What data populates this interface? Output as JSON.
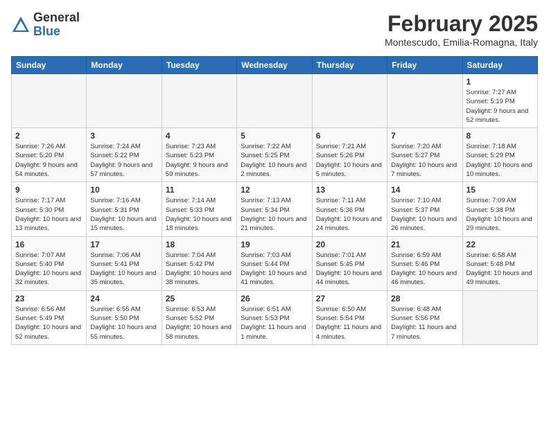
{
  "header": {
    "logo": {
      "general": "General",
      "blue": "Blue"
    },
    "title": "February 2025",
    "subtitle": "Montescudo, Emilia-Romagna, Italy"
  },
  "calendar": {
    "weekdays": [
      "Sunday",
      "Monday",
      "Tuesday",
      "Wednesday",
      "Thursday",
      "Friday",
      "Saturday"
    ],
    "weeks": [
      [
        {
          "day": "",
          "info": ""
        },
        {
          "day": "",
          "info": ""
        },
        {
          "day": "",
          "info": ""
        },
        {
          "day": "",
          "info": ""
        },
        {
          "day": "",
          "info": ""
        },
        {
          "day": "",
          "info": ""
        },
        {
          "day": "1",
          "info": "Sunrise: 7:27 AM\nSunset: 5:19 PM\nDaylight: 9 hours and 52 minutes."
        }
      ],
      [
        {
          "day": "2",
          "info": "Sunrise: 7:26 AM\nSunset: 5:20 PM\nDaylight: 9 hours and 54 minutes."
        },
        {
          "day": "3",
          "info": "Sunrise: 7:24 AM\nSunset: 5:22 PM\nDaylight: 9 hours and 57 minutes."
        },
        {
          "day": "4",
          "info": "Sunrise: 7:23 AM\nSunset: 5:23 PM\nDaylight: 9 hours and 59 minutes."
        },
        {
          "day": "5",
          "info": "Sunrise: 7:22 AM\nSunset: 5:25 PM\nDaylight: 10 hours and 2 minutes."
        },
        {
          "day": "6",
          "info": "Sunrise: 7:21 AM\nSunset: 5:26 PM\nDaylight: 10 hours and 5 minutes."
        },
        {
          "day": "7",
          "info": "Sunrise: 7:20 AM\nSunset: 5:27 PM\nDaylight: 10 hours and 7 minutes."
        },
        {
          "day": "8",
          "info": "Sunrise: 7:18 AM\nSunset: 5:29 PM\nDaylight: 10 hours and 10 minutes."
        }
      ],
      [
        {
          "day": "9",
          "info": "Sunrise: 7:17 AM\nSunset: 5:30 PM\nDaylight: 10 hours and 13 minutes."
        },
        {
          "day": "10",
          "info": "Sunrise: 7:16 AM\nSunset: 5:31 PM\nDaylight: 10 hours and 15 minutes."
        },
        {
          "day": "11",
          "info": "Sunrise: 7:14 AM\nSunset: 5:33 PM\nDaylight: 10 hours and 18 minutes."
        },
        {
          "day": "12",
          "info": "Sunrise: 7:13 AM\nSunset: 5:34 PM\nDaylight: 10 hours and 21 minutes."
        },
        {
          "day": "13",
          "info": "Sunrise: 7:11 AM\nSunset: 5:36 PM\nDaylight: 10 hours and 24 minutes."
        },
        {
          "day": "14",
          "info": "Sunrise: 7:10 AM\nSunset: 5:37 PM\nDaylight: 10 hours and 26 minutes."
        },
        {
          "day": "15",
          "info": "Sunrise: 7:09 AM\nSunset: 5:38 PM\nDaylight: 10 hours and 29 minutes."
        }
      ],
      [
        {
          "day": "16",
          "info": "Sunrise: 7:07 AM\nSunset: 5:40 PM\nDaylight: 10 hours and 32 minutes."
        },
        {
          "day": "17",
          "info": "Sunrise: 7:06 AM\nSunset: 5:41 PM\nDaylight: 10 hours and 35 minutes."
        },
        {
          "day": "18",
          "info": "Sunrise: 7:04 AM\nSunset: 5:42 PM\nDaylight: 10 hours and 38 minutes."
        },
        {
          "day": "19",
          "info": "Sunrise: 7:03 AM\nSunset: 5:44 PM\nDaylight: 10 hours and 41 minutes."
        },
        {
          "day": "20",
          "info": "Sunrise: 7:01 AM\nSunset: 5:45 PM\nDaylight: 10 hours and 44 minutes."
        },
        {
          "day": "21",
          "info": "Sunrise: 6:59 AM\nSunset: 5:46 PM\nDaylight: 10 hours and 46 minutes."
        },
        {
          "day": "22",
          "info": "Sunrise: 6:58 AM\nSunset: 5:48 PM\nDaylight: 10 hours and 49 minutes."
        }
      ],
      [
        {
          "day": "23",
          "info": "Sunrise: 6:56 AM\nSunset: 5:49 PM\nDaylight: 10 hours and 52 minutes."
        },
        {
          "day": "24",
          "info": "Sunrise: 6:55 AM\nSunset: 5:50 PM\nDaylight: 10 hours and 55 minutes."
        },
        {
          "day": "25",
          "info": "Sunrise: 6:53 AM\nSunset: 5:52 PM\nDaylight: 10 hours and 58 minutes."
        },
        {
          "day": "26",
          "info": "Sunrise: 6:51 AM\nSunset: 5:53 PM\nDaylight: 11 hours and 1 minute."
        },
        {
          "day": "27",
          "info": "Sunrise: 6:50 AM\nSunset: 5:54 PM\nDaylight: 11 hours and 4 minutes."
        },
        {
          "day": "28",
          "info": "Sunrise: 6:48 AM\nSunset: 5:56 PM\nDaylight: 11 hours and 7 minutes."
        },
        {
          "day": "",
          "info": ""
        }
      ]
    ]
  }
}
